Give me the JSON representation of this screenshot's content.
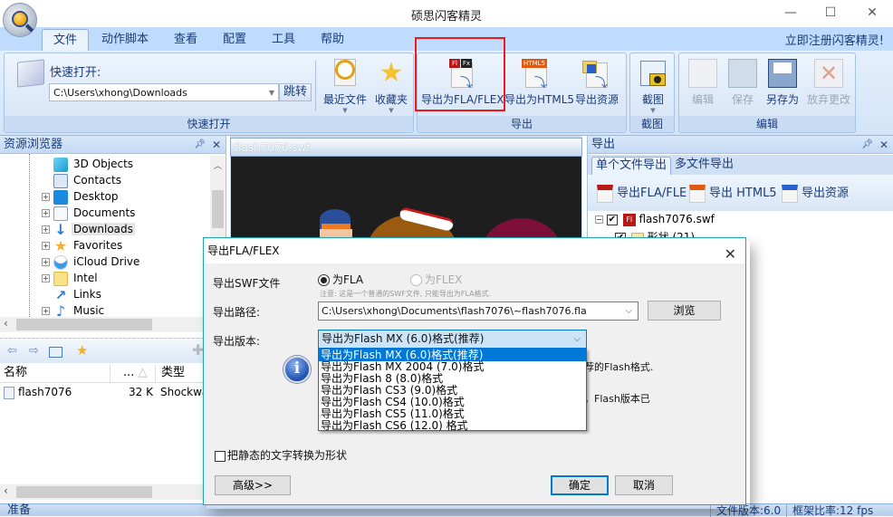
{
  "window": {
    "title": "硕思闪客精灵",
    "minimize_icon": "minimize-icon",
    "maximize_icon": "maximize-icon",
    "close_icon": "close-icon"
  },
  "menu": {
    "tabs": [
      "文件",
      "动作脚本",
      "查看",
      "配置",
      "工具",
      "帮助"
    ],
    "active_tab": "文件",
    "register_link": "立即注册闪客精灵!"
  },
  "ribbon": {
    "quick_open": {
      "label": "快速打开:",
      "path_value": "C:\\Users\\xhong\\Downloads",
      "go_button": "跳转",
      "group_label": "快速打开",
      "recent_files": "最近文件",
      "favorites": "收藏夹"
    },
    "export": {
      "group_label": "导出",
      "fla_flex": "导出为FLA/FLEX",
      "html5": "导出为HTML5",
      "resources": "导出资源"
    },
    "capture": {
      "group_label": "截图",
      "screenshot": "截图"
    },
    "edit": {
      "group_label": "编辑",
      "edit": "编辑",
      "save": "保存",
      "save_as": "另存为",
      "discard": "放弃更改"
    }
  },
  "resource_browser": {
    "title": "资源浏览器",
    "tree": [
      {
        "label": "3D Objects",
        "expandable": false,
        "icon": "cube-icon"
      },
      {
        "label": "Contacts",
        "expandable": false,
        "icon": "contacts-icon"
      },
      {
        "label": "Desktop",
        "expandable": true,
        "icon": "desktop-icon"
      },
      {
        "label": "Documents",
        "expandable": true,
        "icon": "documents-icon"
      },
      {
        "label": "Downloads",
        "expandable": true,
        "icon": "download-arrow-icon",
        "selected": true
      },
      {
        "label": "Favorites",
        "expandable": true,
        "icon": "star-icon"
      },
      {
        "label": "iCloud Drive",
        "expandable": true,
        "icon": "cloud-icon"
      },
      {
        "label": "Intel",
        "expandable": true,
        "icon": "folder-icon"
      },
      {
        "label": "Links",
        "expandable": false,
        "icon": "link-arrow-icon"
      },
      {
        "label": "Music",
        "expandable": true,
        "icon": "music-note-icon"
      }
    ],
    "list_columns": [
      "名称",
      "...",
      "类型"
    ],
    "files": [
      {
        "name": "flash7076",
        "size": "32 K",
        "type": "Shockwa"
      }
    ]
  },
  "preview": {
    "title": "flash7076.swf"
  },
  "export_panel": {
    "title": "导出",
    "tabs": [
      "单个文件导出",
      "多文件导出"
    ],
    "active_tab": "单个文件导出",
    "toolbar": [
      "导出FLA/FLE",
      "导出 HTML5",
      "导出资源"
    ],
    "tree": [
      {
        "label": "flash7076.swf",
        "checked": true
      },
      {
        "label": "形状 (21)",
        "checked": true
      }
    ]
  },
  "status": {
    "ready": "准备",
    "file_version": "文件版本:6.0",
    "frame_rate": "框架比率:12 fps"
  },
  "dialog": {
    "title": "导出FLA/FLEX",
    "swf_label": "导出SWF文件",
    "radio_fla": "为FLA",
    "radio_flex": "为FLEX",
    "selected_radio": "为FLA",
    "note": "注意: 这是一个普通的SWF文件, 只能导出为FLA格式.",
    "path_label": "导出路径:",
    "path_value": "C:\\Users\\xhong\\Documents\\flash7076\\~flash7076.fla",
    "browse": "浏览",
    "version_label": "导出版本:",
    "version_selected": "导出为Flash MX (6.0)格式(推荐)",
    "version_options": [
      "导出为Flash MX (6.0)格式(推荐)",
      "导出为Flash MX 2004 (7.0)格式",
      "导出为Flash 8 (8.0)格式",
      "导出为Flash CS3 (9.0)格式",
      "导出为Flash CS4 (10.0)格式",
      "导出为Flash CS5 (11.0)格式",
      "导出为Flash CS6 (12.0) 格式"
    ],
    "info_line1_tail": "荐的Flash格式.",
    "info_line2_tail": "。Flash版本已",
    "convert_checkbox": "把静态的文字转换为形状",
    "convert_checked": false,
    "advanced": "高级>>",
    "ok": "确定",
    "cancel": "取消"
  },
  "colors": {
    "highlight_box": "#f01818",
    "dialog_border": "#1ea5b4",
    "selection": "#0078d7",
    "ribbon_text": "#1b3c78"
  }
}
